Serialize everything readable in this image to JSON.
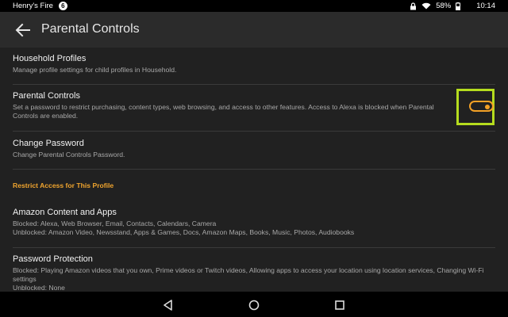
{
  "status_bar": {
    "user_name": "Henry's Fire",
    "notification_count": "6",
    "battery": "58%",
    "time": "10:14"
  },
  "app_bar": {
    "title": "Parental Controls",
    "back_icon": "arrow-left-icon"
  },
  "preferences": {
    "household_profiles": {
      "title": "Household Profiles",
      "summary": "Manage profile settings for child profiles in Household."
    },
    "parental_controls": {
      "title": "Parental Controls",
      "summary": "Set a password to restrict purchasing, content types, web browsing, and access to other features. Access to Alexa is blocked when Parental Controls are enabled.",
      "toggle_state": "on"
    },
    "change_password": {
      "title": "Change Password",
      "summary": "Change Parental Controls Password."
    },
    "section_header": "Restrict Access for This Profile",
    "amazon_content": {
      "title": "Amazon Content and Apps",
      "blocked": "Blocked: Alexa, Web Browser, Email, Contacts, Calendars, Camera",
      "unblocked": "Unblocked: Amazon Video, Newsstand, Apps & Games, Docs, Amazon Maps, Books, Music, Photos, Audiobooks"
    },
    "password_protection": {
      "title": "Password Protection",
      "blocked": "Blocked: Playing Amazon videos that you own, Prime videos or Twitch videos, Allowing apps to access your location using location services, Changing Wi-Fi settings",
      "unblocked": "Unblocked: None"
    }
  },
  "colors": {
    "accent": "#f3a126",
    "highlight": "#b5dc1e",
    "background": "#212121",
    "app_bar": "#2b2b2b"
  },
  "nav_bar": {
    "back_icon": "triangle-back-icon",
    "home_icon": "circle-home-icon",
    "recents_icon": "square-recents-icon"
  }
}
